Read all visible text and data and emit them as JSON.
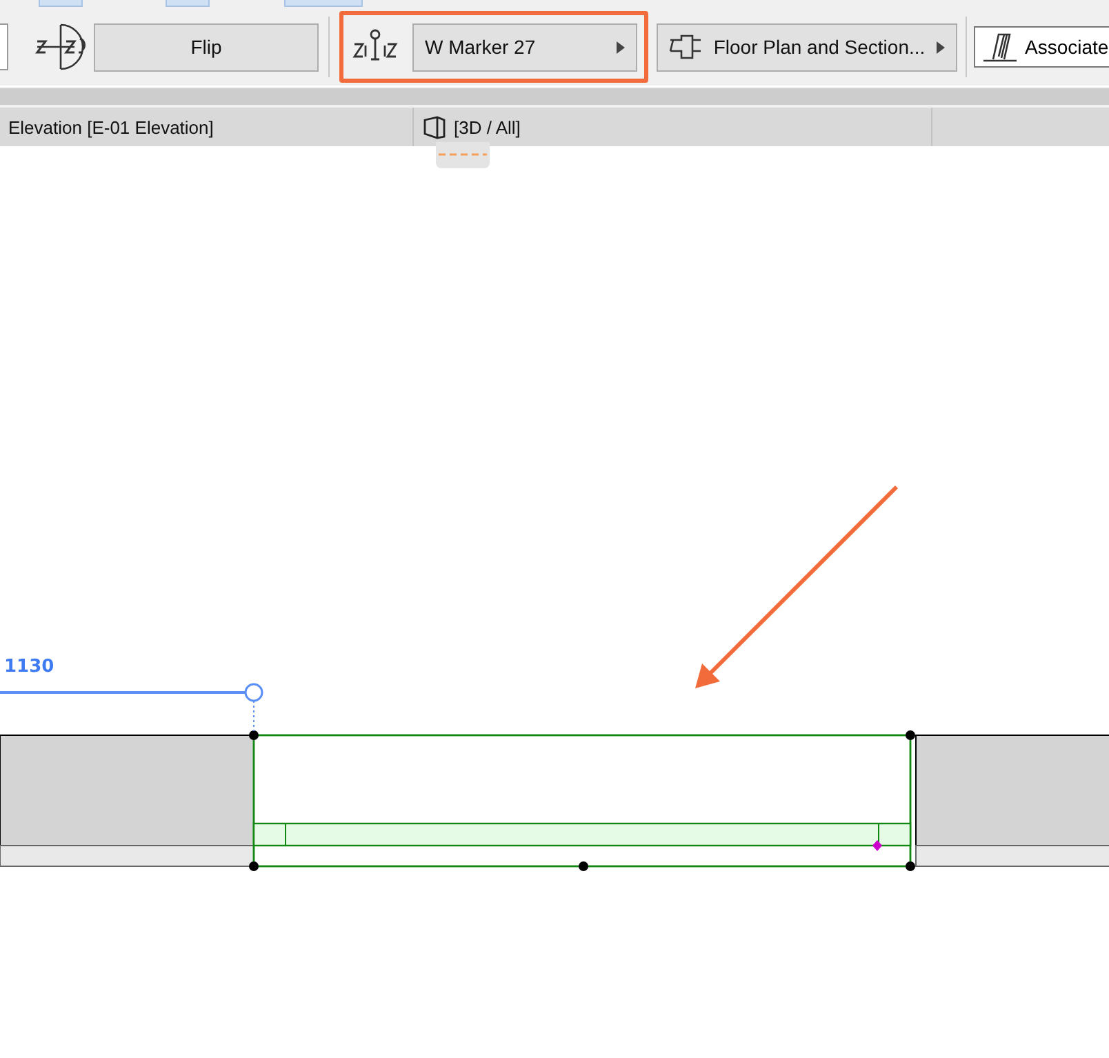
{
  "toolbar": {
    "flip_button": {
      "label": "Flip"
    },
    "marker_dropdown": {
      "value": "W Marker 27"
    },
    "view_dropdown": {
      "value": "Floor Plan and Section..."
    },
    "associated_field": {
      "value": "Associate"
    }
  },
  "tabs": [
    {
      "label": "Elevation [E-01 Elevation]"
    },
    {
      "label": "[3D / All]"
    }
  ],
  "canvas": {
    "dimension_label": "1130"
  }
}
